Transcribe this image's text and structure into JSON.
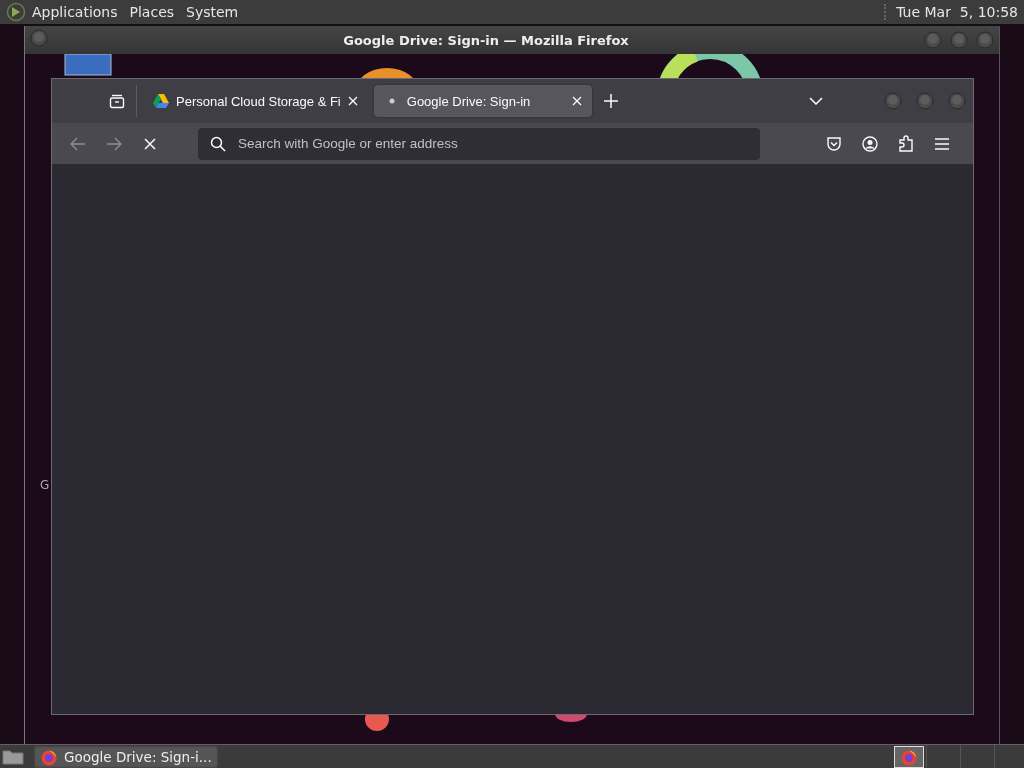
{
  "top_panel": {
    "menus": [
      {
        "label": "Applications"
      },
      {
        "label": "Places"
      },
      {
        "label": "System"
      }
    ],
    "clock": "Tue Mar  5, 10:58"
  },
  "outer_window": {
    "title": "Google Drive: Sign-in — Mozilla Firefox"
  },
  "desktop_fragment": "G",
  "browser": {
    "tabs": [
      {
        "title": "Personal Cloud Storage & Fi",
        "selected": false,
        "kind": "drive"
      },
      {
        "title": "Google Drive: Sign-in",
        "selected": true,
        "kind": "loading"
      }
    ],
    "address_bar": {
      "placeholder": "Search with Google or enter address"
    },
    "loading": true
  },
  "taskbar": {
    "tasks": [
      {
        "label": "Google Drive: Sign-i...",
        "selected": true
      }
    ]
  }
}
